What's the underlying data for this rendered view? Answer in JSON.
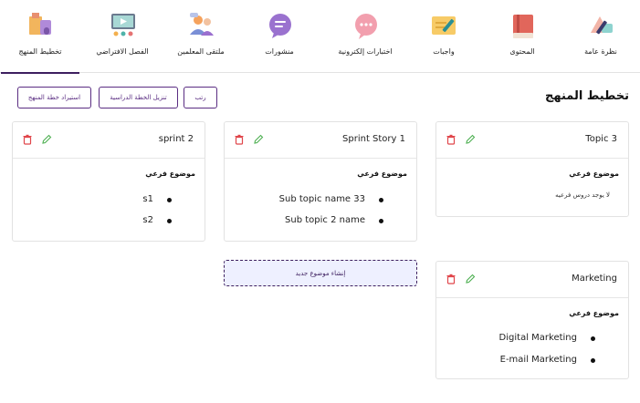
{
  "nav": [
    {
      "key": "overview",
      "label": "نظرة عامة",
      "icon": "overview-icon",
      "active": false
    },
    {
      "key": "content",
      "label": "المحتوى",
      "icon": "book-icon",
      "active": false
    },
    {
      "key": "assignments",
      "label": "واجبات",
      "icon": "assignment-icon",
      "active": false
    },
    {
      "key": "quizzes",
      "label": "اختبارات إلكترونية",
      "icon": "chat-bubble-icon",
      "active": false
    },
    {
      "key": "posts",
      "label": "منشورات",
      "icon": "message-icon",
      "active": false
    },
    {
      "key": "forum",
      "label": "ملتقى المعلمين",
      "icon": "teachers-icon",
      "active": false
    },
    {
      "key": "virtual",
      "label": "الفصل الافتراضي",
      "icon": "virtual-class-icon",
      "active": false
    },
    {
      "key": "planning",
      "label": "تخطيط المنهج",
      "icon": "planning-icon",
      "active": true
    }
  ],
  "page": {
    "title": "تخطيط المنهج",
    "buttons": {
      "sort": "رتب",
      "download": "تنزيل الخطة الدراسية",
      "import": "استيراد خطة المنهج"
    },
    "new_topic": "إنشاء موضوع جديد",
    "subtopic_heading": "موضوع فرعي",
    "no_subtopics": "لا يوجد دروس فرعيه"
  },
  "cards": {
    "topic3": {
      "title": "Topic 3",
      "items": []
    },
    "sprint_story": {
      "title": "Sprint Story 1",
      "items": [
        "Sub topic name 33",
        "Sub topic 2 name"
      ]
    },
    "sprint2": {
      "title": "sprint 2",
      "items": [
        "s1",
        "s2"
      ]
    },
    "marketing": {
      "title": "Marketing",
      "items": [
        "Digital Marketing",
        "E-mail Marketing"
      ]
    }
  },
  "colors": {
    "accent": "#5a2d82",
    "delete": "#e0464b",
    "edit": "#4caf50",
    "new_topic_bg": "#eef0ff"
  }
}
